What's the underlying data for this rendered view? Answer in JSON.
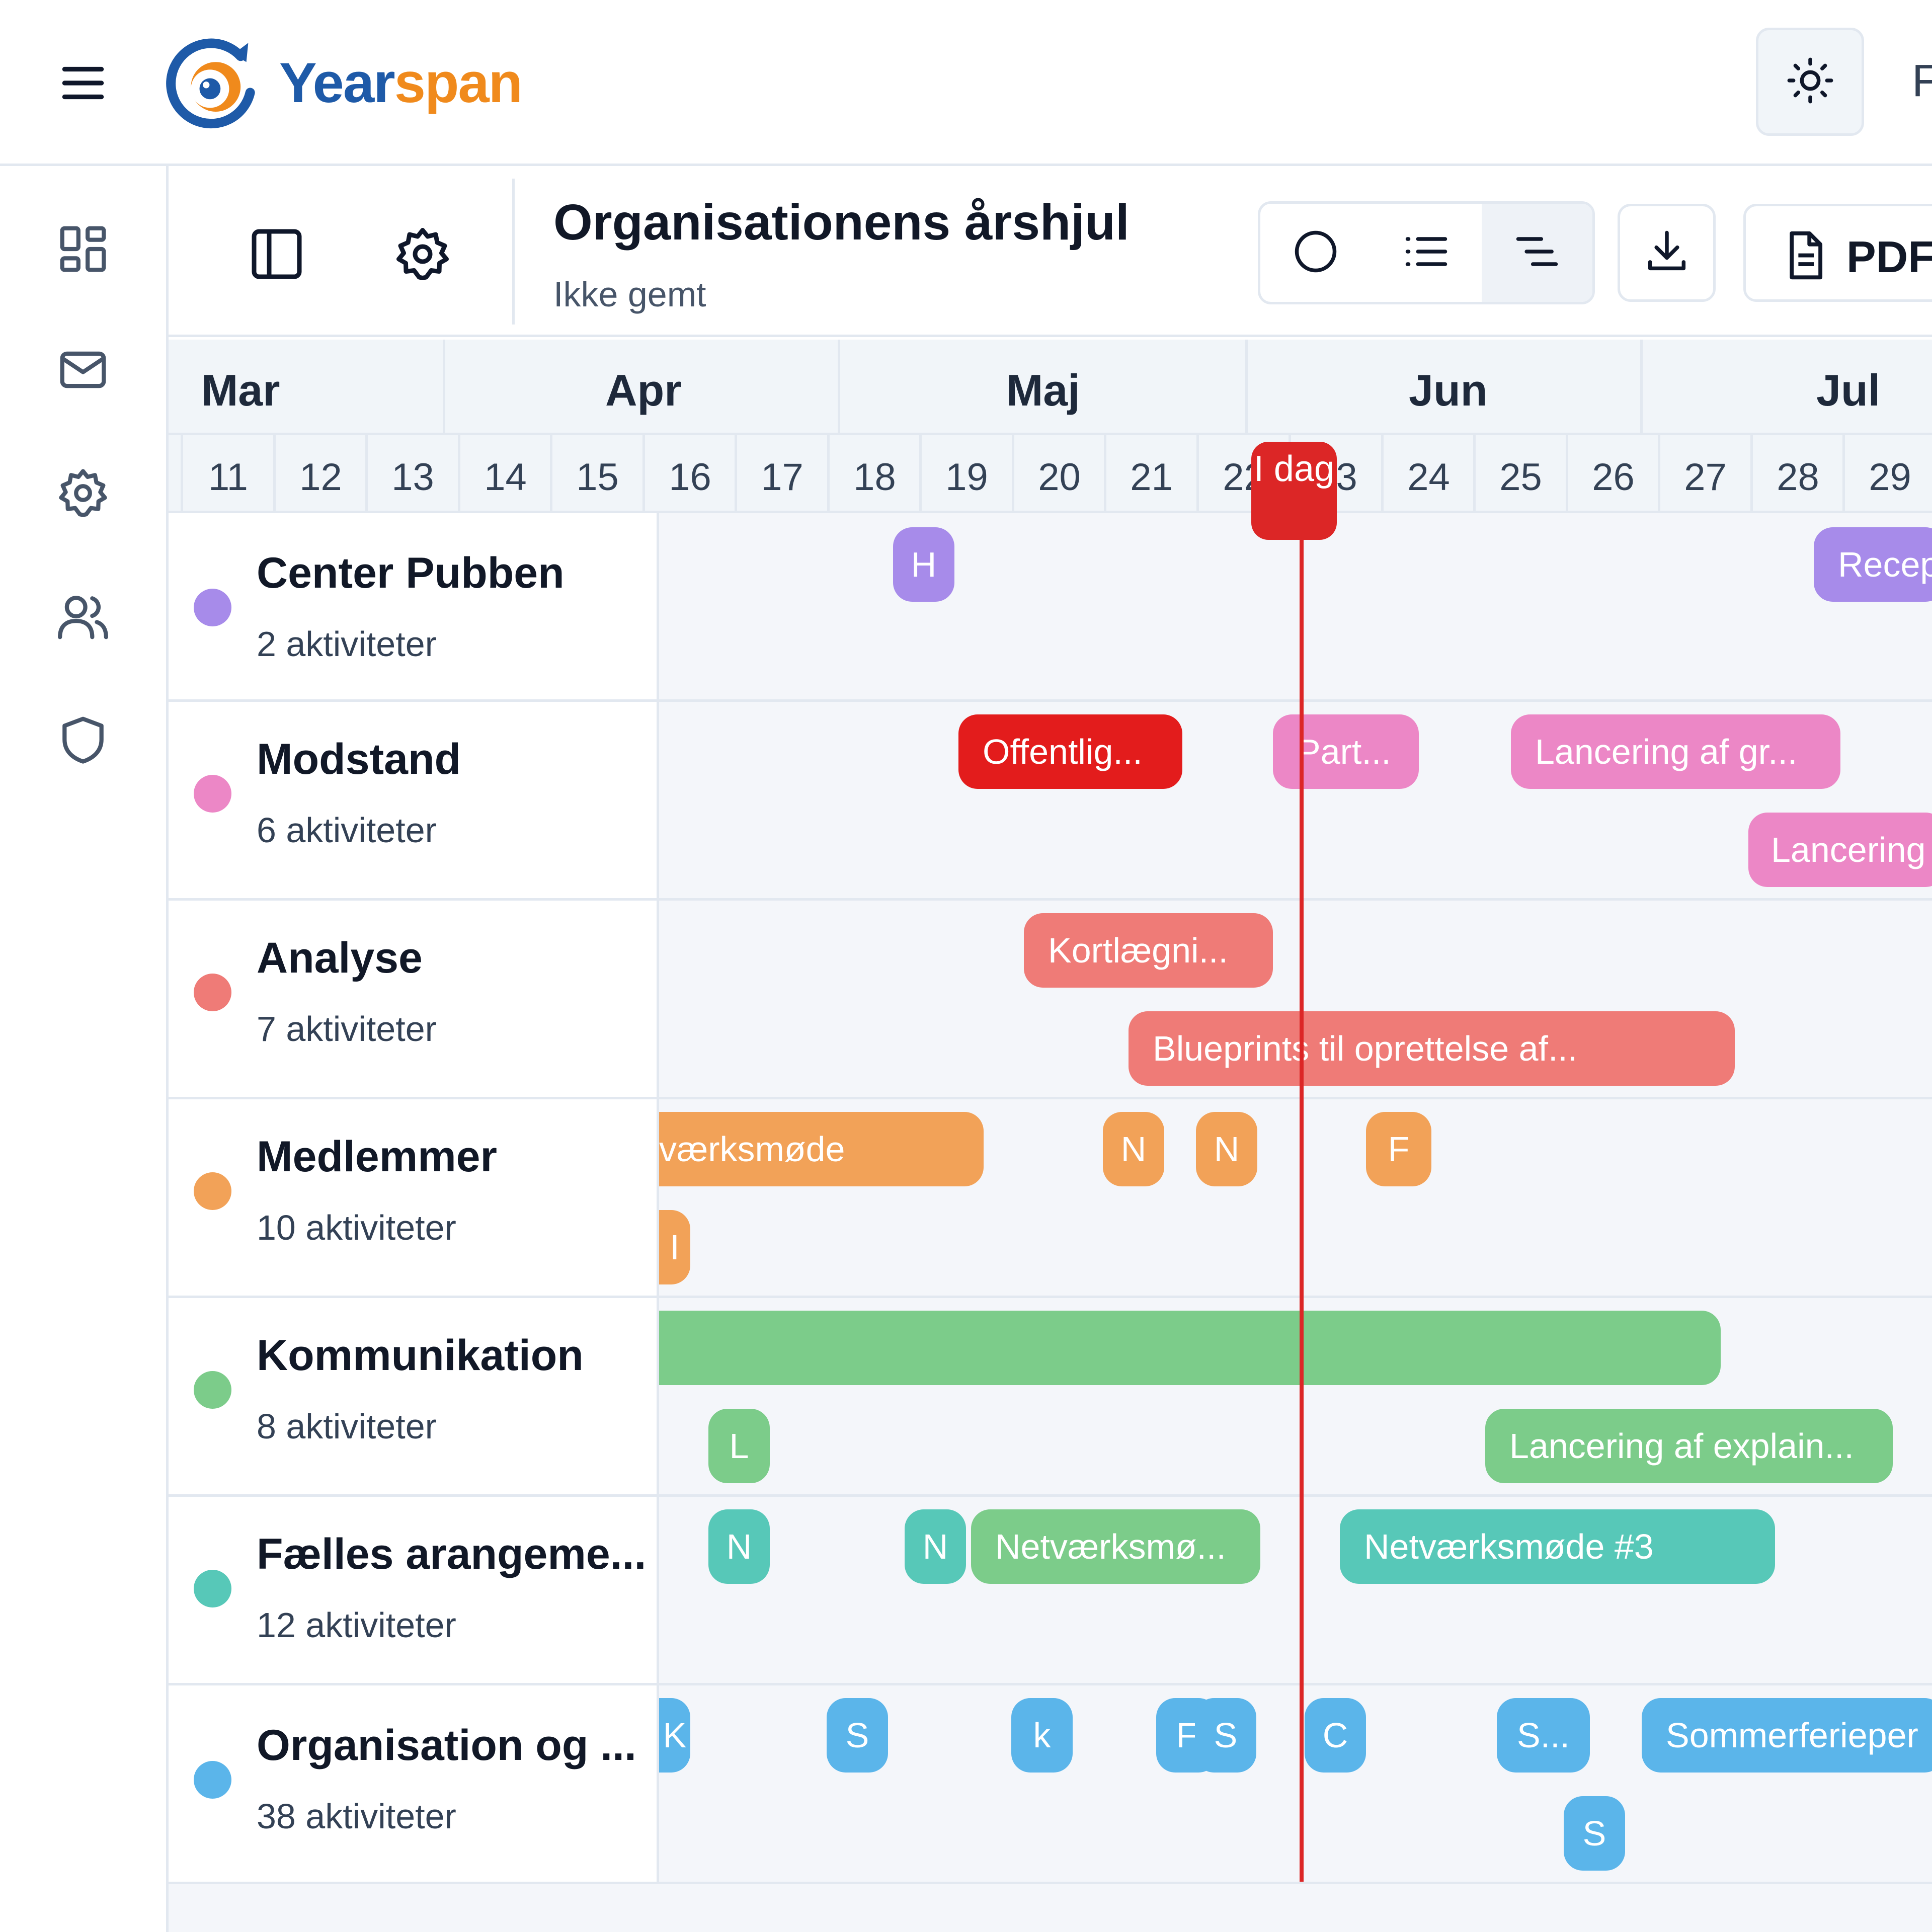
{
  "brand": {
    "part1": "Year",
    "part2": "span"
  },
  "topbar": {
    "cut_label": "F"
  },
  "rail": {
    "items": [
      "dashboard-icon",
      "mail-icon",
      "gear-icon",
      "users-icon",
      "shield-icon"
    ]
  },
  "toolbar": {
    "title": "Organisationens årshjul",
    "save_status": "Ikke gemt",
    "views": [
      "circle-view-icon",
      "list-view-icon",
      "timeline-view-icon"
    ],
    "active_view": "timeline",
    "pdf_label": "PDF"
  },
  "timeline": {
    "months": [
      "Mar",
      "Apr",
      "Maj",
      "Jun",
      "Jul"
    ],
    "weeks": [
      "11",
      "12",
      "13",
      "14",
      "15",
      "16",
      "17",
      "18",
      "19",
      "20",
      "21",
      "22",
      "23",
      "24",
      "25",
      "26",
      "27",
      "28",
      "29"
    ],
    "today_label": "I dag"
  },
  "rows": [
    {
      "name": "Center Pubben",
      "count": "2 aktiviteter",
      "color": "#a78bea"
    },
    {
      "name": "Modstand",
      "count": "6 aktiviteter",
      "color": "#ec87c6"
    },
    {
      "name": "Analyse",
      "count": "7 aktiviteter",
      "color": "#ef7b77"
    },
    {
      "name": "Medlemmer",
      "count": "10 aktiviteter",
      "color": "#f2a258"
    },
    {
      "name": "Kommunikation",
      "count": "8 aktiviteter",
      "color": "#7ccc8a"
    },
    {
      "name": "Fælles arangeme...",
      "count": "12 aktiviteter",
      "color": "#57c8b8"
    },
    {
      "name": "Organisation og ...",
      "count": "38 aktiviteter",
      "color": "#5bb5ea"
    }
  ],
  "bars": [
    {
      "label": "H",
      "color": "#a78bea"
    },
    {
      "label": "Recep",
      "color": "#a78bea"
    },
    {
      "label": "Offentlig...",
      "color": "#e31c1c"
    },
    {
      "label": "Part...",
      "color": "#ec87c6"
    },
    {
      "label": "Lancering af gr...",
      "color": "#ec87c6"
    },
    {
      "label": "Lancering",
      "color": "#ec87c6"
    },
    {
      "label": "Kortlægni...",
      "color": "#ef7b77"
    },
    {
      "label": "Blueprints til oprettelse af...",
      "color": "#ef7b77"
    },
    {
      "label": "værksmøde",
      "color": "#f2a258"
    },
    {
      "label": "N",
      "color": "#f2a258"
    },
    {
      "label": "N",
      "color": "#f2a258"
    },
    {
      "label": "F",
      "color": "#f2a258"
    },
    {
      "label": "I",
      "color": "#f2a258"
    },
    {
      "label": "",
      "color": "#7ccc8a"
    },
    {
      "label": "L",
      "color": "#7ccc8a"
    },
    {
      "label": "Lancering af explain...",
      "color": "#7ccc8a"
    },
    {
      "label": "N",
      "color": "#57c8b8"
    },
    {
      "label": "N",
      "color": "#57c8b8"
    },
    {
      "label": "Netværksmø...",
      "color": "#7ccc8a"
    },
    {
      "label": "Netværksmøde #3",
      "color": "#57c8b8"
    },
    {
      "label": "K",
      "color": "#5bb5ea"
    },
    {
      "label": "S",
      "color": "#5bb5ea"
    },
    {
      "label": "k",
      "color": "#5bb5ea"
    },
    {
      "label": "F",
      "color": "#5bb5ea"
    },
    {
      "label": "S",
      "color": "#5bb5ea"
    },
    {
      "label": "C",
      "color": "#5bb5ea"
    },
    {
      "label": "S...",
      "color": "#5bb5ea"
    },
    {
      "label": "Sommerferieper",
      "color": "#5bb5ea"
    },
    {
      "label": "S",
      "color": "#5bb5ea"
    }
  ]
}
